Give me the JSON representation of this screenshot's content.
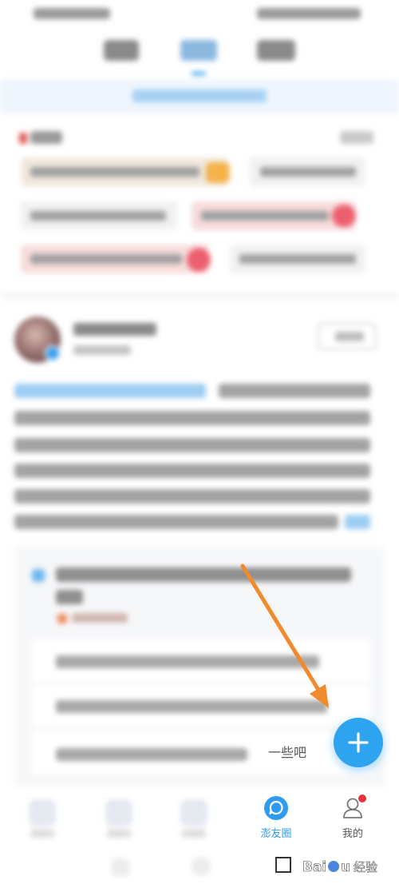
{
  "bottom_nav": {
    "circle_label": "澎友圈",
    "me_label": "我的",
    "me_has_notification": true
  },
  "comment_preview": {
    "visible_text": "一些吧"
  },
  "fab": {
    "icon": "plus-icon"
  },
  "annotation": {
    "arrow_color": "#f08a2c",
    "target": "fab"
  },
  "watermark": {
    "text": "Baidu 经验"
  },
  "colors": {
    "accent": "#2e9bf0",
    "notification": "#e8333a"
  }
}
